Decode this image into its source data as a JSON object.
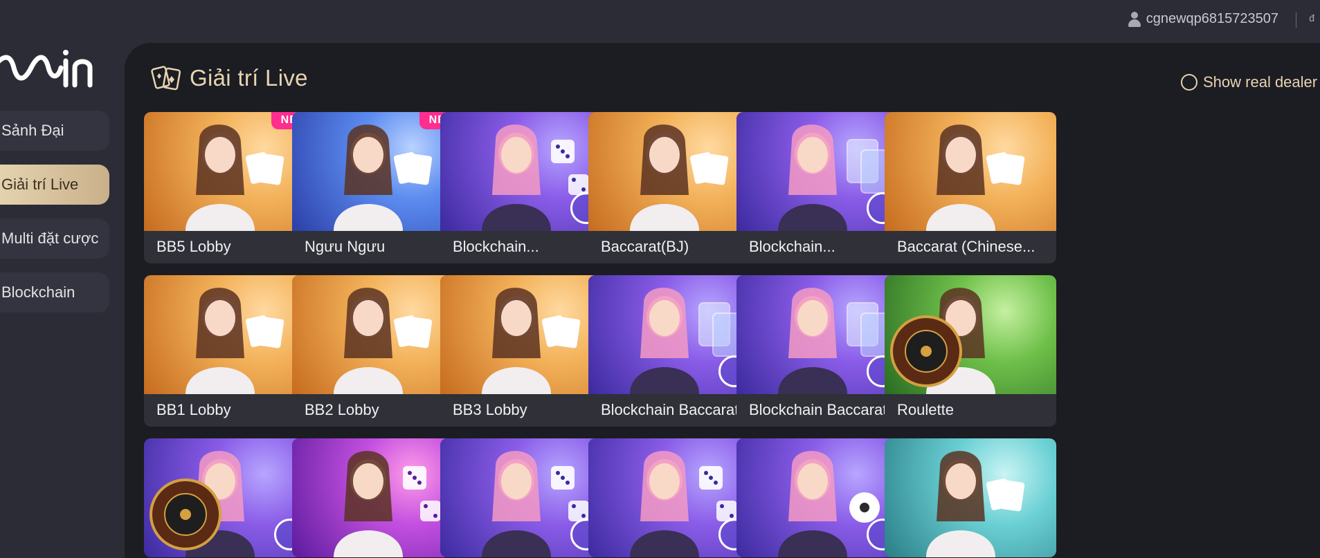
{
  "topbar": {
    "username": "cgnewqp6815723507",
    "extra": "đ"
  },
  "brand": {
    "logo_text": "bbin"
  },
  "sidebar": {
    "items": [
      {
        "label": "Sảnh Đại",
        "active": false
      },
      {
        "label": "Giải trí Live",
        "active": true
      },
      {
        "label": "Multi đặt cược",
        "active": false
      },
      {
        "label": "Blockchain",
        "active": false
      }
    ]
  },
  "main": {
    "title": "Giải trí Live",
    "real_dealer_toggle": "Show real dealer o",
    "badge_new": "NEW",
    "games": [
      {
        "label": "BB5 Lobby",
        "theme": "gold",
        "new": true,
        "art": "dealer-cards"
      },
      {
        "label": "Ngưu Ngưu",
        "theme": "blue",
        "new": true,
        "art": "dealer-cards"
      },
      {
        "label": "Blockchain...",
        "theme": "purple",
        "new": false,
        "art": "dice"
      },
      {
        "label": "Baccarat(BJ)",
        "theme": "gold",
        "new": false,
        "art": "dealer-cards"
      },
      {
        "label": "Blockchain...",
        "theme": "purple",
        "new": false,
        "art": "cards"
      },
      {
        "label": "Baccarat (Chinese...",
        "theme": "gold",
        "new": false,
        "art": "dealer-cards"
      },
      {
        "label": "BB1 Lobby",
        "theme": "gold",
        "new": false,
        "art": "dealer-cards"
      },
      {
        "label": "BB2 Lobby",
        "theme": "gold",
        "new": false,
        "art": "dealer-cards"
      },
      {
        "label": "BB3 Lobby",
        "theme": "gold",
        "new": false,
        "art": "dealer-cards"
      },
      {
        "label": "Blockchain Baccarat",
        "theme": "purple",
        "new": false,
        "art": "cards"
      },
      {
        "label": "Blockchain Baccarat...",
        "theme": "purple",
        "new": false,
        "art": "cards"
      },
      {
        "label": "Roulette",
        "theme": "green",
        "new": false,
        "art": "roulette"
      },
      {
        "label": "",
        "theme": "purple",
        "new": false,
        "art": "roulette"
      },
      {
        "label": "",
        "theme": "magenta",
        "new": false,
        "art": "dice"
      },
      {
        "label": "",
        "theme": "purple",
        "new": false,
        "art": "dice"
      },
      {
        "label": "",
        "theme": "purple",
        "new": false,
        "art": "dice"
      },
      {
        "label": "",
        "theme": "purple",
        "new": false,
        "art": "ball"
      },
      {
        "label": "",
        "theme": "teal",
        "new": false,
        "art": "dealer-cards"
      }
    ]
  },
  "colors": {
    "background": "#2b2c36",
    "panel": "#1c1c23",
    "accent_gold": "#e6d5b0",
    "badge_pink": "#ff2e8f"
  }
}
